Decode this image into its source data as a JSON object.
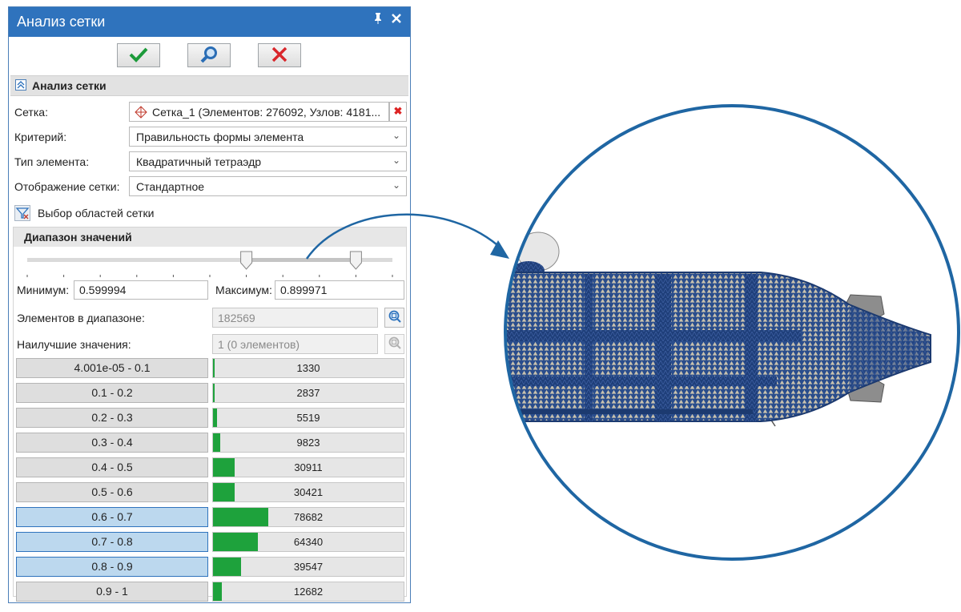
{
  "window": {
    "title": "Анализ сетки",
    "pin_icon": "pin-icon",
    "close_icon": "close-icon"
  },
  "toolbar": {
    "ok_icon": "checkmark-icon",
    "preview_icon": "magnifier-icon",
    "cancel_icon": "cross-icon"
  },
  "section": {
    "title": "Анализ сетки"
  },
  "fields": {
    "mesh_label": "Сетка:",
    "mesh_value": "Сетка_1 (Элементов: 276092, Узлов: 4181...",
    "criterion_label": "Критерий:",
    "criterion_value": "Правильность формы элемента",
    "element_type_label": "Тип элемента:",
    "element_type_value": "Квадратичный тетраэдр",
    "display_label": "Отображение сетки:",
    "display_value": "Стандартное"
  },
  "region_select": {
    "label": "Выбор областей сетки"
  },
  "range": {
    "title": "Диапазон значений",
    "slider_low": 0.599994,
    "slider_high": 0.899971,
    "min_label": "Минимум:",
    "min_value": "0.599994",
    "max_label": "Максимум:",
    "max_value": "0.899971",
    "in_range_label": "Элементов в диапазоне:",
    "in_range_value": "182569",
    "best_label": "Наилучшие значения:",
    "best_value": "1 (0 элементов)"
  },
  "histogram": {
    "max_count": 78682,
    "rows": [
      {
        "range": "4.001e-05 - 0.1",
        "count": "1330",
        "n": 1330,
        "selected": false
      },
      {
        "range": "0.1 - 0.2",
        "count": "2837",
        "n": 2837,
        "selected": false
      },
      {
        "range": "0.2 - 0.3",
        "count": "5519",
        "n": 5519,
        "selected": false
      },
      {
        "range": "0.3 - 0.4",
        "count": "9823",
        "n": 9823,
        "selected": false
      },
      {
        "range": "0.4 - 0.5",
        "count": "30911",
        "n": 30911,
        "selected": false
      },
      {
        "range": "0.5 - 0.6",
        "count": "30421",
        "n": 30421,
        "selected": false
      },
      {
        "range": "0.6 - 0.7",
        "count": "78682",
        "n": 78682,
        "selected": true
      },
      {
        "range": "0.7 - 0.8",
        "count": "64340",
        "n": 64340,
        "selected": true
      },
      {
        "range": "0.8 - 0.9",
        "count": "39547",
        "n": 39547,
        "selected": true
      },
      {
        "range": "0.9 - 1",
        "count": "12682",
        "n": 12682,
        "selected": false
      }
    ]
  },
  "colors": {
    "title_bar": "#2f73bd",
    "histogram_fill": "#1ea23c",
    "selected_row": "#bcd8ee",
    "circle_outline": "#1f66a3",
    "mesh_blue": "#1f3f7a"
  }
}
